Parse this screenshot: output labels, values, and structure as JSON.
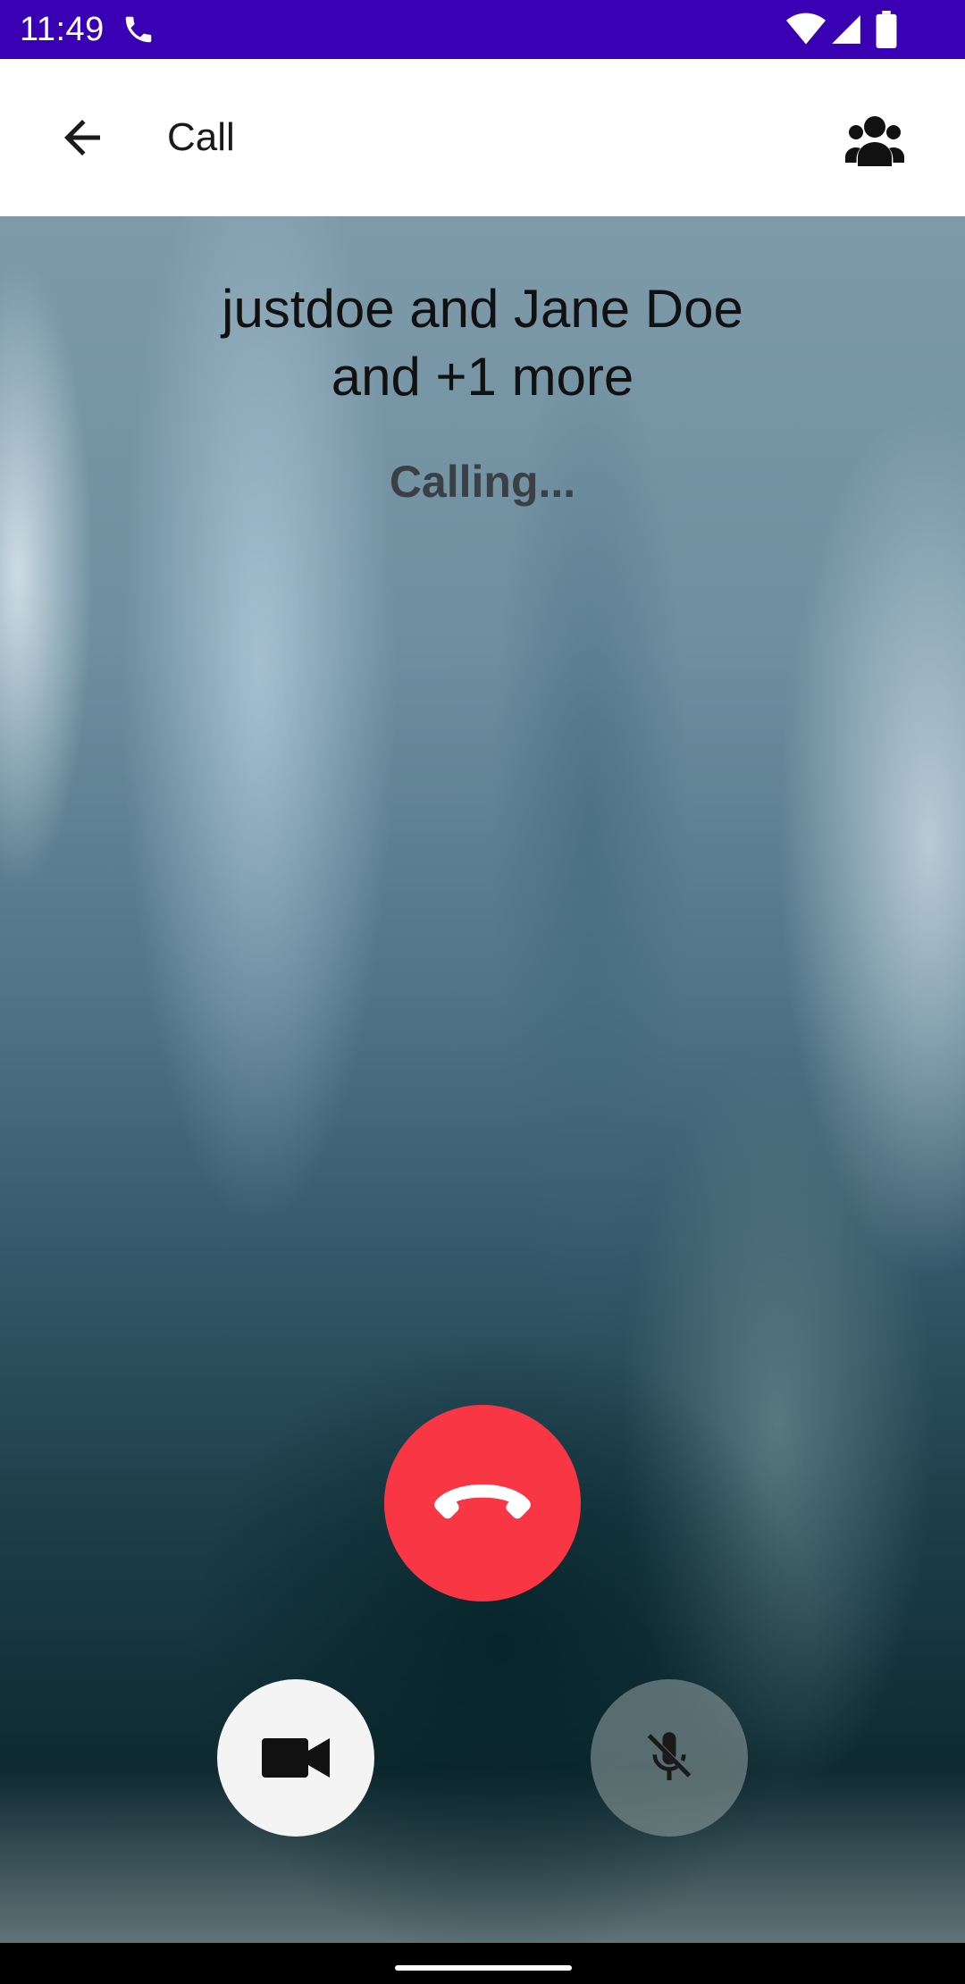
{
  "status_bar": {
    "time": "11:49",
    "color": "#3a00b3",
    "icons": [
      "phone-call-icon",
      "wifi-icon",
      "cell-signal-icon",
      "battery-icon"
    ]
  },
  "app_bar": {
    "title": "Call",
    "back_icon": "arrow-left-icon",
    "participants_icon": "group-icon"
  },
  "call": {
    "names_line1": "justdoe and Jane Doe",
    "names_line2": "and +1 more",
    "status": "Calling...",
    "hangup_color": "#f93644"
  },
  "controls": {
    "video_icon": "videocam-icon",
    "mic_icon": "mic-off-icon"
  }
}
